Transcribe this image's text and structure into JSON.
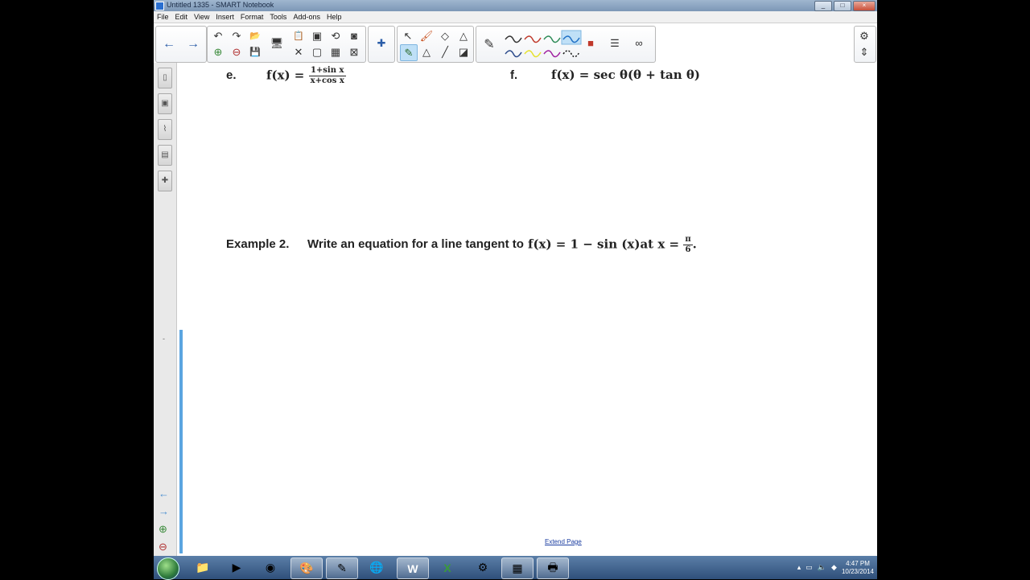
{
  "window": {
    "title": "Untitled 1335 - SMART Notebook",
    "controls": [
      "_",
      "□",
      "×"
    ]
  },
  "menubar": [
    "File",
    "Edit",
    "View",
    "Insert",
    "Format",
    "Tools",
    "Add-ons",
    "Help"
  ],
  "icons": {
    "back": "←",
    "forward": "→",
    "undo": "↶",
    "redo": "↷",
    "open": "📂",
    "add_page": "⊕",
    "delete_page": "⊖",
    "save": "💾",
    "paste": "📋",
    "cut": "✕",
    "screen_shade": "▭",
    "display": "▢",
    "table": "▦",
    "close_box": "⊠",
    "monitor": "🖥",
    "screen_capture": "▣",
    "undo_box": "⟲",
    "capture": "◙",
    "select": "↖",
    "magic_pen": "🖌",
    "eraser": "◇",
    "shape": "△",
    "line": "╱",
    "fill": "◪",
    "pen": "✎",
    "color": "■",
    "properties": "☰",
    "link": "∞",
    "gear": "⚙",
    "move_toolbar": "⇕",
    "puzzle": "✚"
  },
  "pen_colors": [
    "#333333",
    "#c0392b",
    "#2e8b57",
    "#1f6fc5",
    "#2b4a8b",
    "#e6e22e",
    "#a020a0",
    "#111111"
  ],
  "content": {
    "item_e_label": "e.",
    "item_e_lhs": "f(x) =",
    "item_e_num": "1+sin x",
    "item_e_den": "x+cos x",
    "item_f_label": "f.",
    "item_f_expr": "f(x) = sec θ(θ + tan θ)",
    "example_label": "Example 2.",
    "example_text": "Write an equation for a line tangent to",
    "example_math": "f(x) = 1 − sin (x)at x =",
    "example_frac_num": "π",
    "example_frac_den": "6",
    "example_period": ".",
    "extend_link": "Extend Page"
  },
  "taskbar": {
    "time": "4:47 PM",
    "date": "10/23/2014",
    "apps": [
      "explorer",
      "media",
      "chrome",
      "paint",
      "smart",
      "earth",
      "word",
      "excel",
      "network",
      "tool",
      "printer"
    ]
  }
}
